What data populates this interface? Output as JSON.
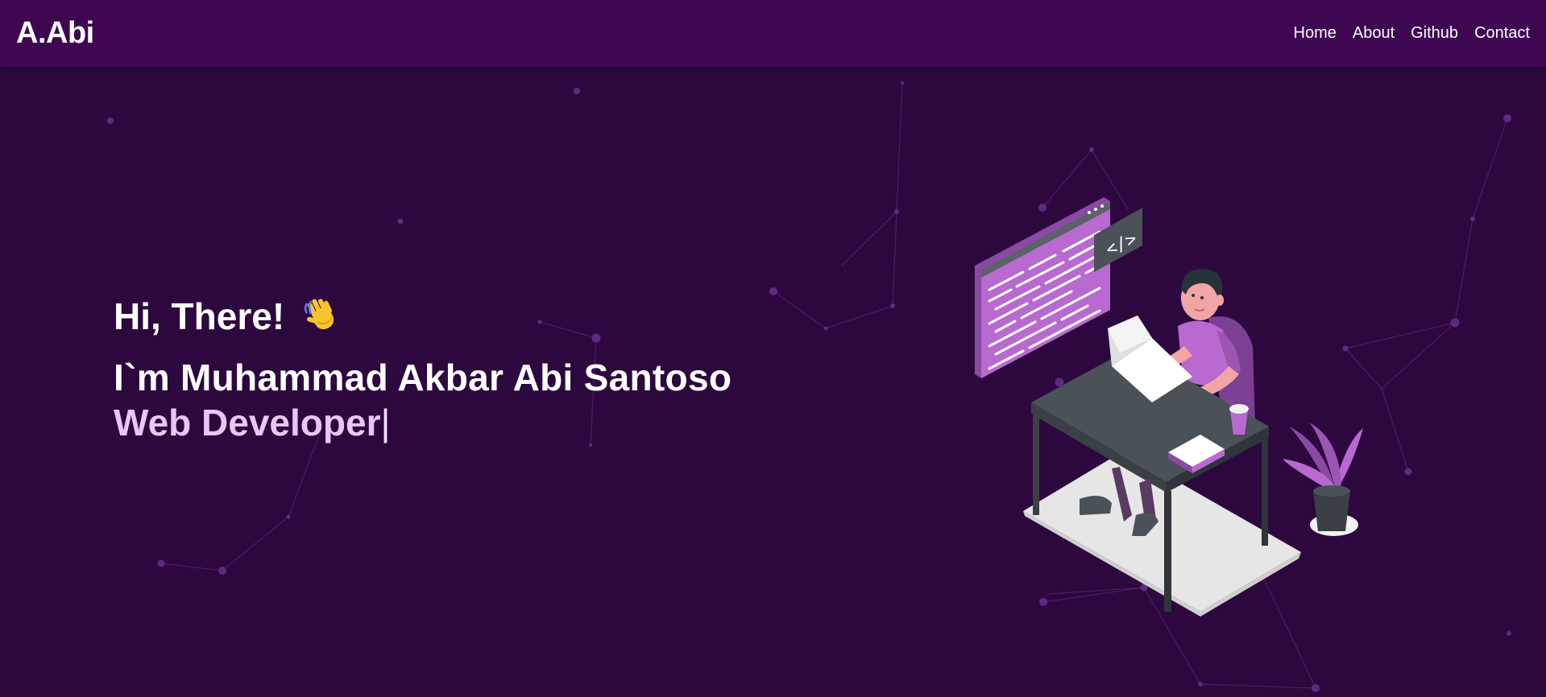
{
  "navbar": {
    "brand": "A.Abi",
    "links": [
      {
        "label": "Home"
      },
      {
        "label": "About"
      },
      {
        "label": "Github"
      },
      {
        "label": "Contact"
      }
    ]
  },
  "hero": {
    "greeting": "Hi, There!",
    "name": "I`m Muhammad Akbar Abi Santoso",
    "role": "Web Developer",
    "cursor": "|"
  },
  "illustration": {
    "code_tag": "</>"
  },
  "colors": {
    "background": "#2d083f",
    "navbar": "#3f0751",
    "accent": "#b86ad0",
    "role_text": "#e8c7f5"
  }
}
